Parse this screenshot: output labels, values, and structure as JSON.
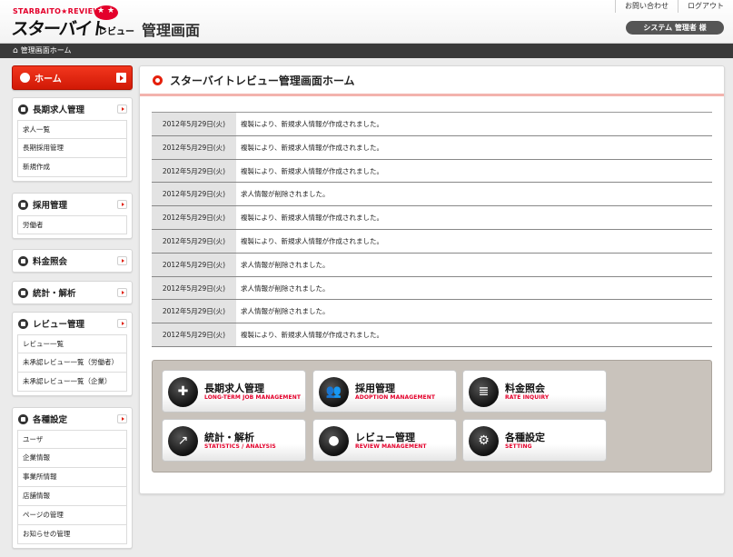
{
  "header": {
    "logo_small": "STARBAITO★REVIEW",
    "logo_big": "スターバイト",
    "logo_sub": "レビュー",
    "logo_badge": "★ ★",
    "title": "管理画面",
    "links": [
      "お問い合わせ",
      "ログアウト"
    ],
    "user": "システム 管理者 様"
  },
  "breadcrumb": {
    "home_glyph": "⌂",
    "label": "管理画面ホーム"
  },
  "sidebar": {
    "home": {
      "label": "ホーム",
      "icon": "home-icon"
    },
    "groups": [
      {
        "label": "長期求人管理",
        "icon": "job-icon",
        "items": [
          "求人一覧",
          "長期採用管理",
          "新規作成"
        ]
      },
      {
        "label": "採用管理",
        "icon": "people-icon",
        "items": [
          "労働者"
        ]
      },
      {
        "label": "料金照会",
        "icon": "money-icon",
        "items": []
      },
      {
        "label": "統計・解析",
        "icon": "chart-icon",
        "items": []
      },
      {
        "label": "レビュー管理",
        "icon": "speech-bubble-icon",
        "items": [
          "レビュー一覧",
          "未承認レビュー一覧（労働者）",
          "未承認レビュー一覧（企業）"
        ]
      },
      {
        "label": "各種設定",
        "icon": "gear-icon",
        "items": [
          "ユーザ",
          "企業情報",
          "事業所情報",
          "店舗情報",
          "ページの管理",
          "お知らせの管理"
        ]
      }
    ]
  },
  "main": {
    "title": "スターバイトレビュー管理画面ホーム",
    "news": [
      {
        "date": "2012年5月29日(火)",
        "text": "複製により、新規求人情報が作成されました。"
      },
      {
        "date": "2012年5月29日(火)",
        "text": "複製により、新規求人情報が作成されました。"
      },
      {
        "date": "2012年5月29日(火)",
        "text": "複製により、新規求人情報が作成されました。"
      },
      {
        "date": "2012年5月29日(火)",
        "text": "求人情報が削除されました。"
      },
      {
        "date": "2012年5月29日(火)",
        "text": "複製により、新規求人情報が作成されました。"
      },
      {
        "date": "2012年5月29日(火)",
        "text": "複製により、新規求人情報が作成されました。"
      },
      {
        "date": "2012年5月29日(火)",
        "text": "求人情報が削除されました。"
      },
      {
        "date": "2012年5月29日(火)",
        "text": "求人情報が削除されました。"
      },
      {
        "date": "2012年5月29日(火)",
        "text": "求人情報が削除されました。"
      },
      {
        "date": "2012年5月29日(火)",
        "text": "複製により、新規求人情報が作成されました。"
      }
    ],
    "quick_links": [
      {
        "label": "長期求人管理",
        "sub": "LONG-TERM JOB MANAGEMENT",
        "icon": "job-icon",
        "glyph": "✚"
      },
      {
        "label": "採用管理",
        "sub": "ADOPTION MANAGEMENT",
        "icon": "people-icon",
        "glyph": "👥"
      },
      {
        "label": "料金照会",
        "sub": "RATE INQUIRY",
        "icon": "money-icon",
        "glyph": "≣"
      },
      {
        "label": "統計・解析",
        "sub": "STATISTICS / ANALYSIS",
        "icon": "chart-icon",
        "glyph": "↗"
      },
      {
        "label": "レビュー管理",
        "sub": "REVIEW MANAGEMENT",
        "icon": "speech-bubble-icon",
        "glyph": "●"
      },
      {
        "label": "各種設定",
        "sub": "SETTING",
        "icon": "gear-icon",
        "glyph": "⚙"
      }
    ]
  },
  "colors": {
    "accent": "#e4002b",
    "breadcrumb_bg": "#3a3a3a",
    "quick_bg": "#c9c3bc"
  }
}
